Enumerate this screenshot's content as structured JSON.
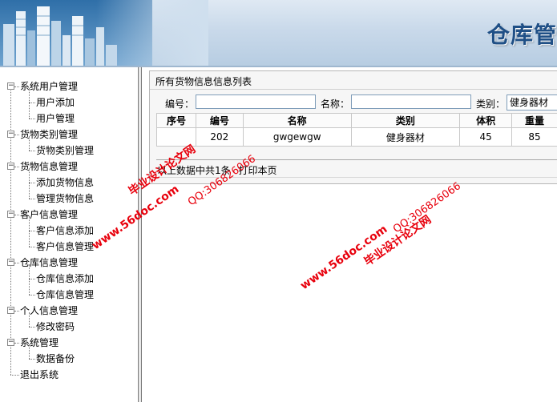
{
  "header": {
    "title": "仓库管"
  },
  "sidebar": {
    "groups": [
      {
        "label": "系统用户管理",
        "items": [
          "用户添加",
          "用户管理"
        ]
      },
      {
        "label": "货物类别管理",
        "items": [
          "货物类别管理"
        ]
      },
      {
        "label": "货物信息管理",
        "items": [
          "添加货物信息",
          "管理货物信息"
        ]
      },
      {
        "label": "客户信息管理",
        "items": [
          "客户信息添加",
          "客户信息管理"
        ]
      },
      {
        "label": "仓库信息管理",
        "items": [
          "仓库信息添加",
          "仓库信息管理"
        ]
      },
      {
        "label": "个人信息管理",
        "items": [
          "修改密码"
        ]
      },
      {
        "label": "系统管理",
        "items": [
          "数据备份"
        ]
      }
    ],
    "exit_label": "退出系统",
    "toggle_glyph": "−"
  },
  "main": {
    "panel_title": "所有货物信息信息列表",
    "search": {
      "code_label": "编号：",
      "code_value": "",
      "name_label": "名称：",
      "name_value": "",
      "category_label": "类别：",
      "category_value": "健身器材"
    },
    "table": {
      "headers": [
        "序号",
        "编号",
        "名称",
        "类别",
        "体积",
        "重量"
      ],
      "rows": [
        [
          "",
          "202",
          "gwgewgw",
          "健身器材",
          "45",
          "85"
        ]
      ]
    },
    "footer": {
      "summary": "以上数据中共1条",
      "print_link": "打印本页"
    }
  },
  "watermarks": {
    "cn": "毕业设计论文网",
    "url": "www.56doc.com",
    "qq": "QQ:306826066",
    "color": "#e8000c"
  }
}
